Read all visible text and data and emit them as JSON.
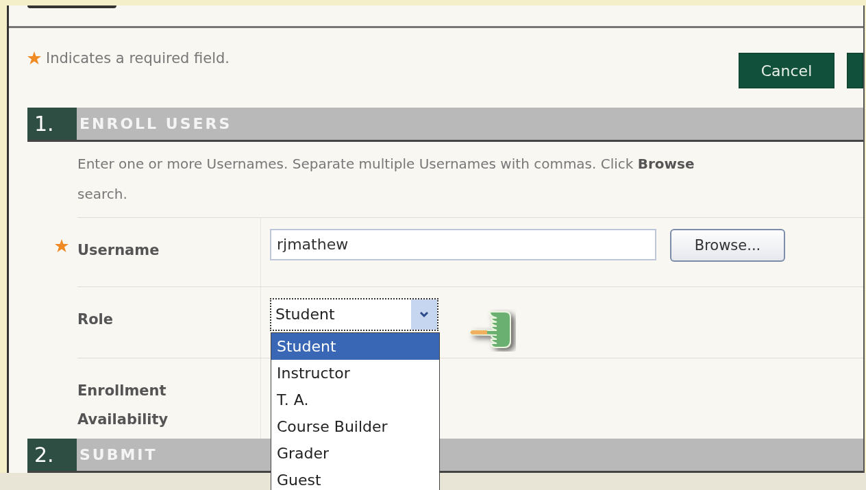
{
  "required_note": {
    "text": "Indicates a required field."
  },
  "actions": [
    {
      "label": "Cancel"
    }
  ],
  "sections": [
    {
      "number": "1.",
      "title": "ENROLL USERS"
    },
    {
      "number": "2.",
      "title": "SUBMIT"
    }
  ],
  "instructions": [
    "Enter one or more Usernames. Separate multiple Usernames with commas. Click **Browse**",
    "search."
  ],
  "username": {
    "label": "Username",
    "required": true,
    "value": "rjmathew",
    "browse": "Browse..."
  },
  "role": {
    "label": "Role",
    "required": false,
    "value": "Student",
    "expanded": true,
    "options": [
      {
        "label": "Student",
        "selected": true
      },
      {
        "label": "Instructor",
        "selected": false
      },
      {
        "label": "T. A.",
        "selected": false
      },
      {
        "label": "Course Builder",
        "selected": false
      },
      {
        "label": "Grader",
        "selected": false
      },
      {
        "label": "Guest",
        "selected": false
      }
    ]
  },
  "availability": {
    "label": "Enrollment Availability",
    "required": false
  }
}
